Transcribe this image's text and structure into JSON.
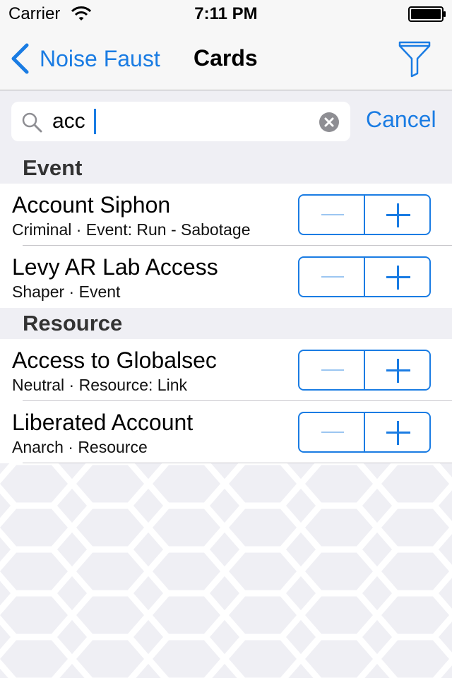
{
  "status_bar": {
    "carrier": "Carrier",
    "time": "7:11 PM"
  },
  "nav": {
    "back_label": "Noise Faust",
    "title": "Cards",
    "filter_icon": "filter-funnel-icon"
  },
  "search": {
    "value": "acc",
    "placeholder": "",
    "cancel_label": "Cancel"
  },
  "sections": [
    {
      "header": "Event",
      "rows": [
        {
          "title": "Account Siphon",
          "subtitle": "Criminal · Event: Run - Sabotage"
        },
        {
          "title": "Levy AR Lab Access",
          "subtitle": "Shaper · Event"
        }
      ]
    },
    {
      "header": "Resource",
      "rows": [
        {
          "title": "Access to Globalsec",
          "subtitle": "Neutral · Resource: Link"
        },
        {
          "title": "Liberated Account",
          "subtitle": "Anarch · Resource"
        }
      ]
    }
  ],
  "colors": {
    "accent": "#1a7ce3",
    "background": "#efeff4",
    "stepper_minus_disabled": "#9cc6f1"
  }
}
